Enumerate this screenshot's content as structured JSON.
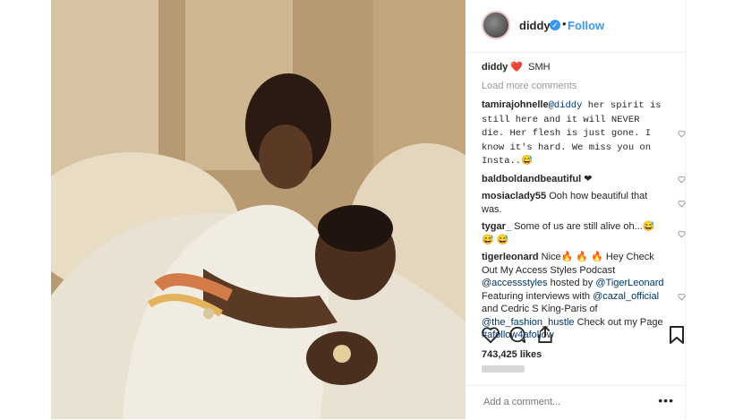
{
  "header": {
    "username": "diddy",
    "follow_label": "Follow",
    "separator": "•"
  },
  "caption": {
    "user": "diddy",
    "emoji": "❤️",
    "text": "SMH"
  },
  "load_more": "Load more comments",
  "comments": [
    {
      "user": "tamirajohnelle",
      "segments": [
        {
          "t": "@diddy",
          "mention": true,
          "mono": true
        },
        {
          "t": " her spirit is still here and it will NEVER die. Her flesh is just gone. I know it's hard. We miss you on Insta..😅",
          "mono": true
        }
      ]
    },
    {
      "user": "baldboldandbeautiful",
      "segments": [
        {
          "t": " ❤"
        }
      ]
    },
    {
      "user": "mosiaclady55",
      "segments": [
        {
          "t": " Ooh how beautiful that was."
        }
      ]
    },
    {
      "user": "tygar_",
      "segments": [
        {
          "t": " Some of us are still alive oh...😅 😅 😅"
        }
      ]
    },
    {
      "user": "tigerleonard",
      "segments": [
        {
          "t": " Nice🔥 🔥 🔥 Hey Check Out My Access Styles Podcast "
        },
        {
          "t": "@accessstyles",
          "mention": true
        },
        {
          "t": "  hosted by "
        },
        {
          "t": "@TigerLeonard",
          "mention": true
        },
        {
          "t": " Featuring interviews with "
        },
        {
          "t": "@cazal_official",
          "mention": true
        },
        {
          "t": " and Cedric S King-Paris of "
        },
        {
          "t": "@the_fashion_hustle",
          "mention": true
        },
        {
          "t": " Check out my Page "
        },
        {
          "t": "#afollow4afollow",
          "mention": true
        }
      ]
    }
  ],
  "likes": "743,425 likes",
  "add_comment_placeholder": "Add a comment...",
  "more_label": "•••",
  "colors": {
    "link": "#003569",
    "follow": "#3897f0",
    "muted": "#999999",
    "border": "#efefef"
  },
  "icons": [
    "heart-icon",
    "comment-icon",
    "share-icon",
    "bookmark-icon",
    "verified-icon"
  ]
}
